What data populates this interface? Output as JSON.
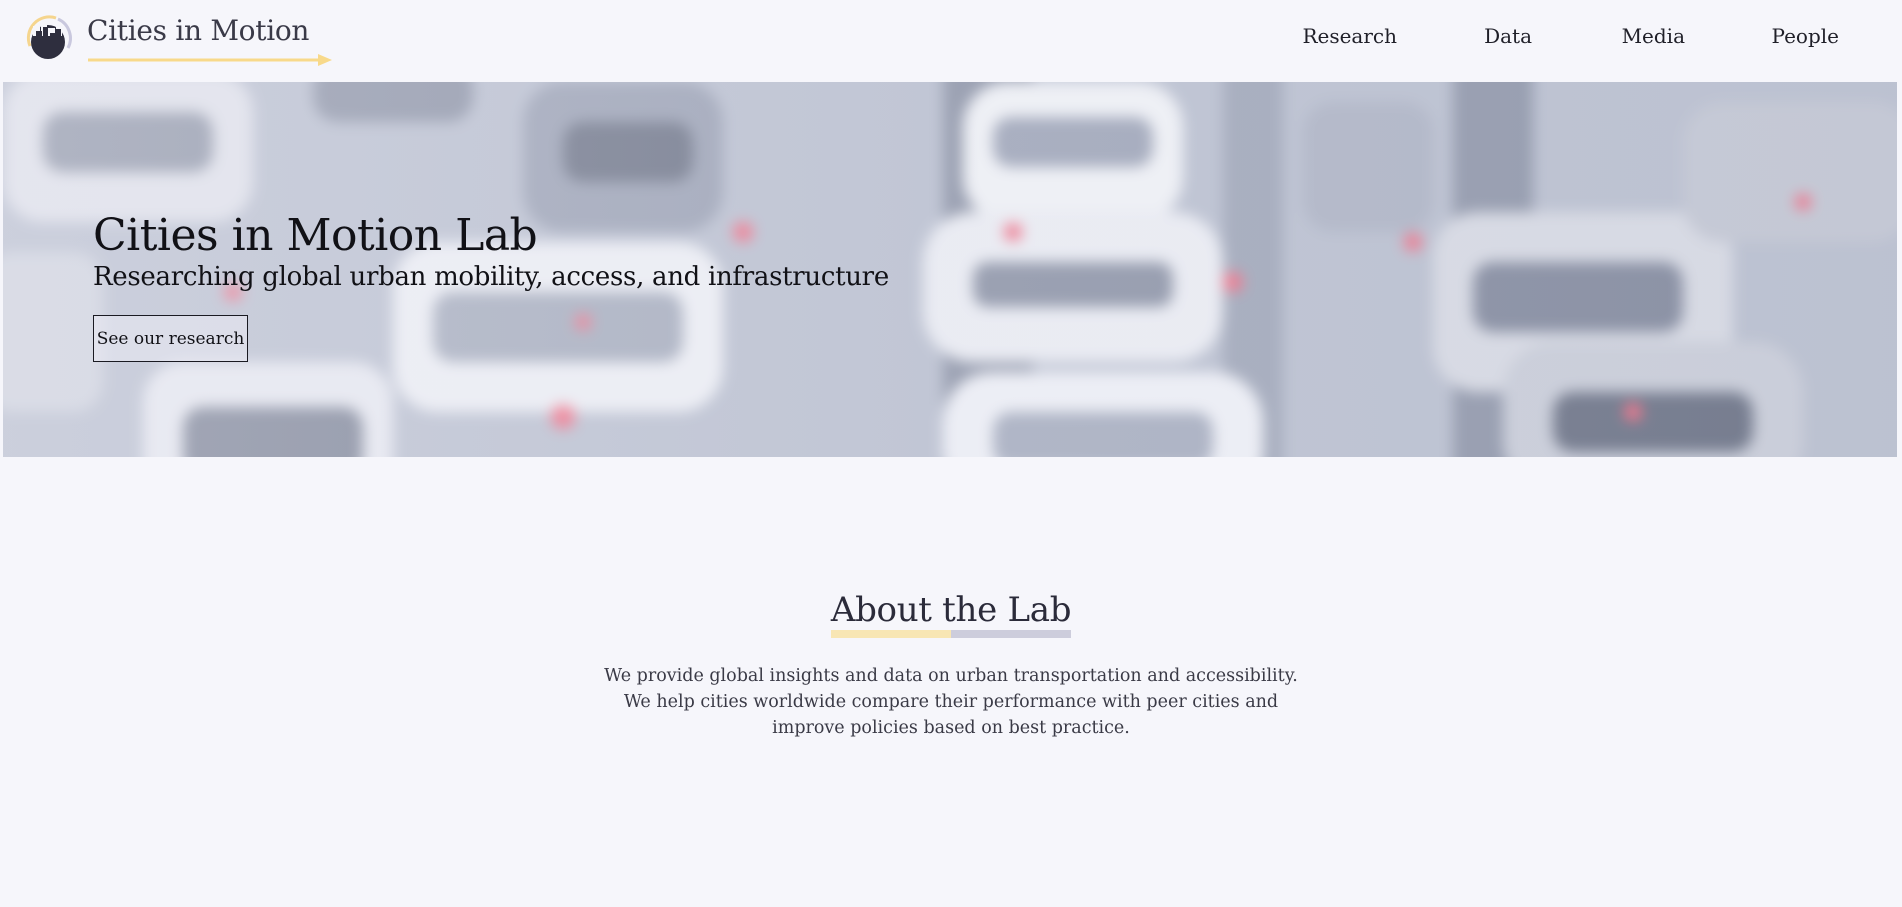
{
  "header": {
    "brand_name": "Cities in Motion",
    "nav": [
      {
        "label": "Research"
      },
      {
        "label": "Data"
      },
      {
        "label": "Media"
      },
      {
        "label": "People"
      }
    ]
  },
  "hero": {
    "title": "Cities in Motion Lab",
    "subtitle": "Researching global urban mobility, access, and infrastructure",
    "button_label": "See our research"
  },
  "about": {
    "title": "About the Lab",
    "body": "We provide global insights and data on urban transportation and accessibility. We help cities worldwide compare their performance with peer cities and improve policies based on best practice."
  },
  "colors": {
    "page_background": "#f6f6fb",
    "accent_yellow": "#f8d98a",
    "accent_lavender": "#cdcddc",
    "logo_dark": "#2e2e3e"
  },
  "icons": {
    "logo": "city-skyline-circle-icon",
    "brand_arrow": "arrow-right-icon"
  }
}
